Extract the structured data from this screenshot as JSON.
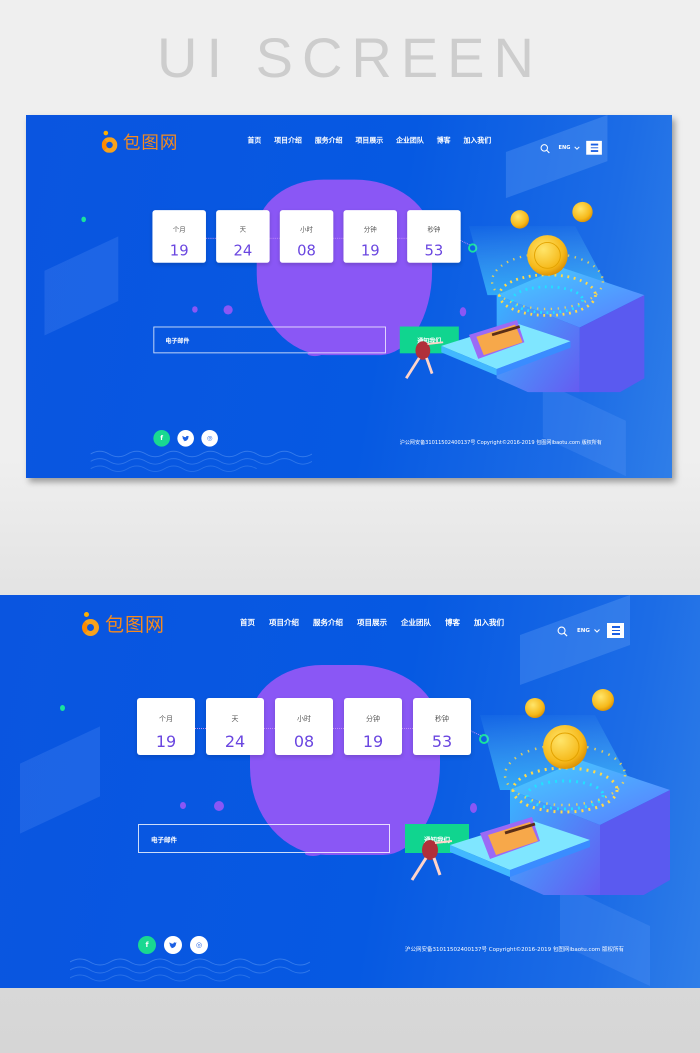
{
  "page_title": "UI SCREEN",
  "screens": [
    {
      "id": "screen-1",
      "logo": {
        "icon": "baotu-logo-icon",
        "text": "包图网"
      },
      "nav": [
        "首页",
        "项目介绍",
        "服务介绍",
        "项目展示",
        "企业团队",
        "博客",
        "加入我们"
      ],
      "header_tools": {
        "search_icon": "search-icon",
        "language": "ENG",
        "language_icon": "chevron-down-icon",
        "menu_icon": "hamburger-menu-icon"
      },
      "countdown": [
        {
          "label": "个月",
          "value": "19"
        },
        {
          "label": "天",
          "value": "24"
        },
        {
          "label": "小时",
          "value": "08"
        },
        {
          "label": "分钟",
          "value": "19"
        },
        {
          "label": "秒钟",
          "value": "53"
        }
      ],
      "email_placeholder": "电子邮件",
      "notify_button": "通知我们",
      "social": [
        {
          "icon": "facebook-icon",
          "glyph": "f"
        },
        {
          "icon": "twitter-icon",
          "glyph": "t"
        },
        {
          "icon": "dribbble-icon",
          "glyph": "◎"
        }
      ],
      "footer": "沪公网安备31011502400137号 Copyright©2016-2019 包图网ibaotu.com 版权所有"
    },
    {
      "id": "screen-2",
      "logo": {
        "icon": "baotu-logo-icon",
        "text": "包图网"
      },
      "nav": [
        "首页",
        "项目介绍",
        "服务介绍",
        "项目展示",
        "企业团队",
        "博客",
        "加入我们"
      ],
      "header_tools": {
        "search_icon": "search-icon",
        "language": "ENG",
        "language_icon": "chevron-down-icon",
        "menu_icon": "hamburger-menu-icon"
      },
      "countdown": [
        {
          "label": "个月",
          "value": "19"
        },
        {
          "label": "天",
          "value": "24"
        },
        {
          "label": "小时",
          "value": "08"
        },
        {
          "label": "分钟",
          "value": "19"
        },
        {
          "label": "秒钟",
          "value": "53"
        }
      ],
      "email_placeholder": "电子邮件",
      "notify_button": "通知我们",
      "social": [
        {
          "icon": "facebook-icon",
          "glyph": "f"
        },
        {
          "icon": "twitter-icon",
          "glyph": "t"
        },
        {
          "icon": "dribbble-icon",
          "glyph": "◎"
        }
      ],
      "footer": "沪公网安备31011502400137号 Copyright©2016-2019 包图网ibaotu.com 版权所有"
    }
  ],
  "colors": {
    "primary_blue": "#0659e2",
    "blob_purple": "#8a57f5",
    "accent_green": "#10d58f",
    "logo_orange": "#f58a1e",
    "countdown_value": "#6a46e0"
  }
}
